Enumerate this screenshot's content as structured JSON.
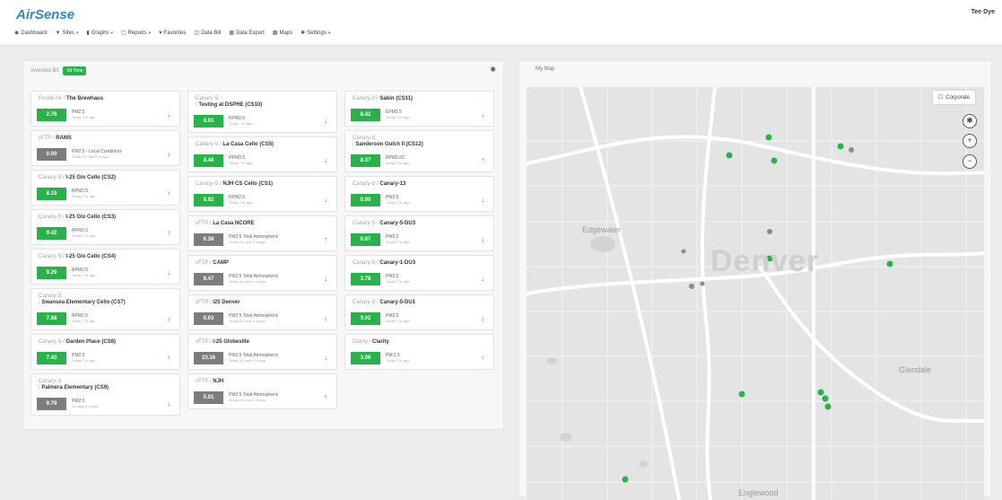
{
  "app": {
    "logo": "AirSense",
    "user": "Tee Dye"
  },
  "nav": [
    {
      "icon": "dashboard-icon",
      "glyph": "◉",
      "label": "Dashboard",
      "caret": false
    },
    {
      "icon": "sites-icon",
      "glyph": "▼",
      "label": "Sites",
      "caret": true
    },
    {
      "icon": "graphs-icon",
      "glyph": "▮",
      "label": "Graphs",
      "caret": true
    },
    {
      "icon": "reports-icon",
      "glyph": "▢",
      "label": "Reports",
      "caret": true
    },
    {
      "icon": "favorites-icon",
      "glyph": "♥",
      "label": "Favorites",
      "caret": false
    },
    {
      "icon": "data-bill-icon",
      "glyph": "◫",
      "label": "Data Bill",
      "caret": false
    },
    {
      "icon": "data-export-icon",
      "glyph": "▦",
      "label": "Data Export",
      "caret": false
    },
    {
      "icon": "maps-icon",
      "glyph": "▩",
      "label": "Maps",
      "caret": false
    },
    {
      "icon": "settings-icon",
      "glyph": "✱",
      "label": "Settings",
      "caret": true
    }
  ],
  "left_panel": {
    "header": "Invested Bit",
    "toggle": "Sit Time"
  },
  "columns": [
    [
      {
        "net": "Purple Air",
        "loc": "The Brewhaus",
        "value": "2.76",
        "status": "g",
        "metric": "PM2.5",
        "time": "Today 9 hr ago",
        "arrow": "↓"
      },
      {
        "net": "sFTP",
        "loc": "RAMS",
        "value": "0.00",
        "status": "x",
        "metric": "PM2.5 - Local Conditions",
        "time": "Today 2.6 and 3 hr ago",
        "arrow": "↓"
      },
      {
        "net": "Canary-S",
        "loc": "I-25 Glo Cello (CS2)",
        "value": "8.19",
        "status": "g",
        "metric": "RPM2.5",
        "time": "Today 7 hr ago",
        "arrow": "↑"
      },
      {
        "net": "Canary-S",
        "loc": "I-25 Glo Cello (CS3)",
        "value": "9.42",
        "status": "g",
        "metric": "RPM2.5",
        "time": "Today 7 hr ago",
        "arrow": "↑"
      },
      {
        "net": "Canary-S",
        "loc": "I-25 Glo Cello (CS4)",
        "value": "9.29",
        "status": "g",
        "metric": "RPM2.5",
        "time": "Today 7 hr ago",
        "arrow": "↓"
      },
      {
        "net": "Canary-S",
        "loc": "Swansea Elementary Cello (CS7)",
        "value": "7.88",
        "status": "g",
        "metric": "RPM2.5",
        "time": "Today 7 hr ago",
        "arrow": "↓",
        "tall": true
      },
      {
        "net": "Canary-S",
        "loc": "Garden Place (CS8)",
        "value": "7.43",
        "status": "g",
        "metric": "PM2.5",
        "time": "Today 7 hr ago",
        "arrow": "↑"
      },
      {
        "net": "Canary-S",
        "loc": "Palmera Elementary (CS9)",
        "value": "9.79",
        "status": "x",
        "metric": "PM2.5",
        "time": "10 days 8 hr ago",
        "arrow": "↓",
        "tall": true
      }
    ],
    [
      {
        "net": "Canary-S",
        "loc": "Testing at DSPHE (CS10)",
        "value": "8.03",
        "status": "g",
        "metric": "RPM2.5",
        "time": "Today 7 hr ago",
        "arrow": "↓",
        "tall": true
      },
      {
        "net": "Canary-S",
        "loc": "La Casa Cello (CS5)",
        "value": "8.48",
        "status": "g",
        "metric": "RPM2.5",
        "time": "Today 7 hr ago",
        "arrow": "↓"
      },
      {
        "net": "Canary-S",
        "loc": "NJH CS Cello (CS1)",
        "value": "8.92",
        "status": "g",
        "metric": "RPM2.5",
        "time": "Today 7 hr ago",
        "arrow": "↓"
      },
      {
        "net": "sFTP",
        "loc": "La Casa NCORE",
        "value": "6.38",
        "status": "x",
        "metric": "PM2.5 Total Atmospheric",
        "time": "Today 2.6 and 3 hr ago",
        "arrow": "↑"
      },
      {
        "net": "sFTP",
        "loc": "CAMP",
        "value": "8.47",
        "status": "x",
        "metric": "PM2.5 Total Atmospheric",
        "time": "Today 2.6 and 3 hr ago",
        "arrow": "↓"
      },
      {
        "net": "sFTP",
        "loc": "I25 Denver",
        "value": "0.03",
        "status": "x",
        "metric": "PM2.5 Total Atmospheric",
        "time": "Today 2.6 and 3 hr ago",
        "arrow": "↓"
      },
      {
        "net": "sFTP",
        "loc": "I-25 Globeville",
        "value": "23.16",
        "status": "x",
        "metric": "PM2.5 Total Atmospheric",
        "time": "Today 2.6 and 3 hr ago",
        "arrow": "↓"
      },
      {
        "net": "sFTP",
        "loc": "NJH",
        "value": "5.01",
        "status": "x",
        "metric": "PM2.5 Total Atmospheric",
        "time": "Today 2.6 and 3 hr ago",
        "arrow": "↑"
      }
    ],
    [
      {
        "net": "Canary-S",
        "loc": "Sabin (CS11)",
        "value": "8.42",
        "status": "g",
        "metric": "EPM2.5",
        "time": "Today 7 hr ago",
        "arrow": "↓"
      },
      {
        "net": "Canary-S",
        "loc": "Sanderson Gulch II (CS12)",
        "value": "8.37",
        "status": "g",
        "metric": "RPM2.5C",
        "time": "Today 7 hr ago",
        "arrow": "↑",
        "tall": true
      },
      {
        "net": "Canary-S",
        "loc": "Canary-13",
        "value": "0.00",
        "status": "g",
        "metric": "PM2.5",
        "time": "Today 7 hr ago",
        "arrow": "↓"
      },
      {
        "net": "Canary-S",
        "loc": "Canary-5-DU3",
        "value": "0.87",
        "status": "g",
        "metric": "PM2.5",
        "time": "Today 7 hr ago",
        "arrow": "↓"
      },
      {
        "net": "Canary-S",
        "loc": "Canary-1-DU3",
        "value": "3.78",
        "status": "g",
        "metric": "PM2.5",
        "time": "Today 7 hr ago",
        "arrow": "↓"
      },
      {
        "net": "Canary-S",
        "loc": "Canary-5-DU1",
        "value": "3.02",
        "status": "g",
        "metric": "PM2.5",
        "time": "Today 7 hr ago",
        "arrow": "↓"
      },
      {
        "net": "Clarity",
        "loc": "Clarity",
        "value": "3.06",
        "status": "g",
        "metric": "PM 2.5",
        "time": "Today 7 hr ago",
        "arrow": "↑"
      }
    ]
  ],
  "map_panel": {
    "title": "My Map",
    "layer_button": "Corporate"
  },
  "map_labels": {
    "city": "Denver",
    "englewood": "Englewood",
    "glendale": "Glendale",
    "edgewater": "Edgewater"
  },
  "colors": {
    "accent": "#2f88c6",
    "good": "#27b34a",
    "stale": "#7d7d7d"
  }
}
